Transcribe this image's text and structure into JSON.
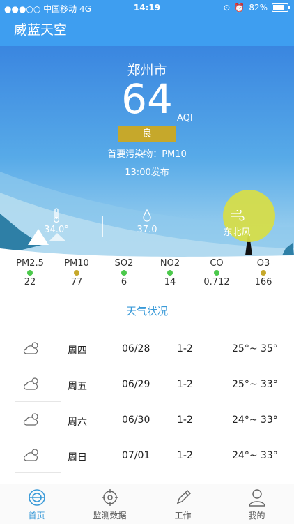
{
  "status_bar": {
    "carrier": "●●●○○ 中国移动  4G",
    "time": "14:19",
    "battery": "82%",
    "battery_level": 0.82
  },
  "app": {
    "title": "威蓝天空"
  },
  "aqi": {
    "city": "郑州市",
    "value": "64",
    "unit": "AQI",
    "level": "良",
    "primary_pollutant": "首要污染物：PM10",
    "published": "13:00发布"
  },
  "current_weather": [
    {
      "icon": "thermometer-icon",
      "value": "34.0°"
    },
    {
      "icon": "humidity-drop-icon",
      "value": "37.0"
    },
    {
      "icon": "wind-icon",
      "value": "东北风"
    }
  ],
  "pollutants": [
    {
      "name": "PM2.5",
      "value": "22",
      "color": "#4cc94c"
    },
    {
      "name": "PM10",
      "value": "77",
      "color": "#c6a82b"
    },
    {
      "name": "SO2",
      "value": "6",
      "color": "#4cc94c"
    },
    {
      "name": "NO2",
      "value": "14",
      "color": "#4cc94c"
    },
    {
      "name": "CO",
      "value": "0.712",
      "color": "#4cc94c"
    },
    {
      "name": "O3",
      "value": "166",
      "color": "#c6a82b"
    }
  ],
  "forecast_title": "天气状况",
  "forecast": [
    {
      "icon": "partly-cloudy-icon",
      "day": "周四",
      "date": "06/28",
      "wind": "1-2",
      "temp": "25°~ 35°"
    },
    {
      "icon": "partly-cloudy-icon",
      "day": "周五",
      "date": "06/29",
      "wind": "1-2",
      "temp": "25°~ 33°"
    },
    {
      "icon": "partly-cloudy-icon",
      "day": "周六",
      "date": "06/30",
      "wind": "1-2",
      "temp": "24°~ 33°"
    },
    {
      "icon": "partly-cloudy-icon",
      "day": "周日",
      "date": "07/01",
      "wind": "1-2",
      "temp": "24°~ 33°"
    }
  ],
  "tabs": [
    {
      "label": "首页",
      "icon": "home-icon",
      "active": true
    },
    {
      "label": "监测数据",
      "icon": "target-icon",
      "active": false
    },
    {
      "label": "工作",
      "icon": "pencil-icon",
      "active": false
    },
    {
      "label": "我的",
      "icon": "user-icon",
      "active": false
    }
  ],
  "colors": {
    "primary": "#3e9ef0",
    "accent_text": "#3a9ad8",
    "good_green": "#4cc94c",
    "moderate_yellow": "#c6a82b"
  }
}
